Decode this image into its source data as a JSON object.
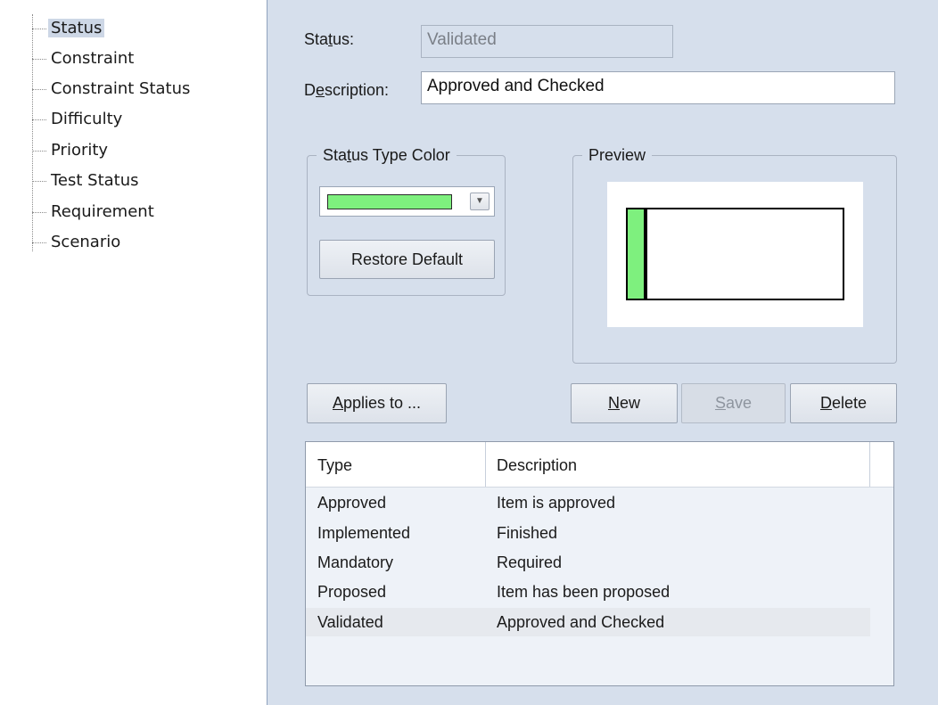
{
  "tree": {
    "items": [
      {
        "label": "Status",
        "selected": true
      },
      {
        "label": "Constraint"
      },
      {
        "label": "Constraint Status"
      },
      {
        "label": "Difficulty"
      },
      {
        "label": "Priority"
      },
      {
        "label": "Test Status"
      },
      {
        "label": "Requirement"
      },
      {
        "label": "Scenario"
      }
    ]
  },
  "form": {
    "status_label_pre": "Sta",
    "status_label_mnemonic": "t",
    "status_label_post": "us:",
    "status_value": "Validated",
    "description_label_pre": "D",
    "description_label_mnemonic": "e",
    "description_label_post": "scription:",
    "description_value": "Approved and Checked"
  },
  "status_type_color": {
    "legend_pre": "Sta",
    "legend_mnemonic": "t",
    "legend_post": "us Type Color",
    "selected_color": "#7ef07e",
    "dropdown_icon": "chevron-down-icon",
    "restore_default_label": "Restore Default"
  },
  "preview": {
    "legend": "Preview",
    "status_bar_color": "#7ef07e"
  },
  "buttons": {
    "applies_to_mnemonic": "A",
    "applies_to_rest": "pplies to ...",
    "new_mnemonic": "N",
    "new_rest": "ew",
    "save_mnemonic": "S",
    "save_rest": "ave",
    "delete_mnemonic": "D",
    "delete_rest": "elete"
  },
  "list": {
    "columns": [
      "Type",
      "Description"
    ],
    "rows": [
      {
        "type": "Approved",
        "description": "Item is approved"
      },
      {
        "type": "Implemented",
        "description": "Finished"
      },
      {
        "type": "Mandatory",
        "description": "Required"
      },
      {
        "type": "Proposed",
        "description": "Item has been proposed"
      },
      {
        "type": "Validated",
        "description": "Approved and Checked",
        "selected": true
      }
    ]
  }
}
